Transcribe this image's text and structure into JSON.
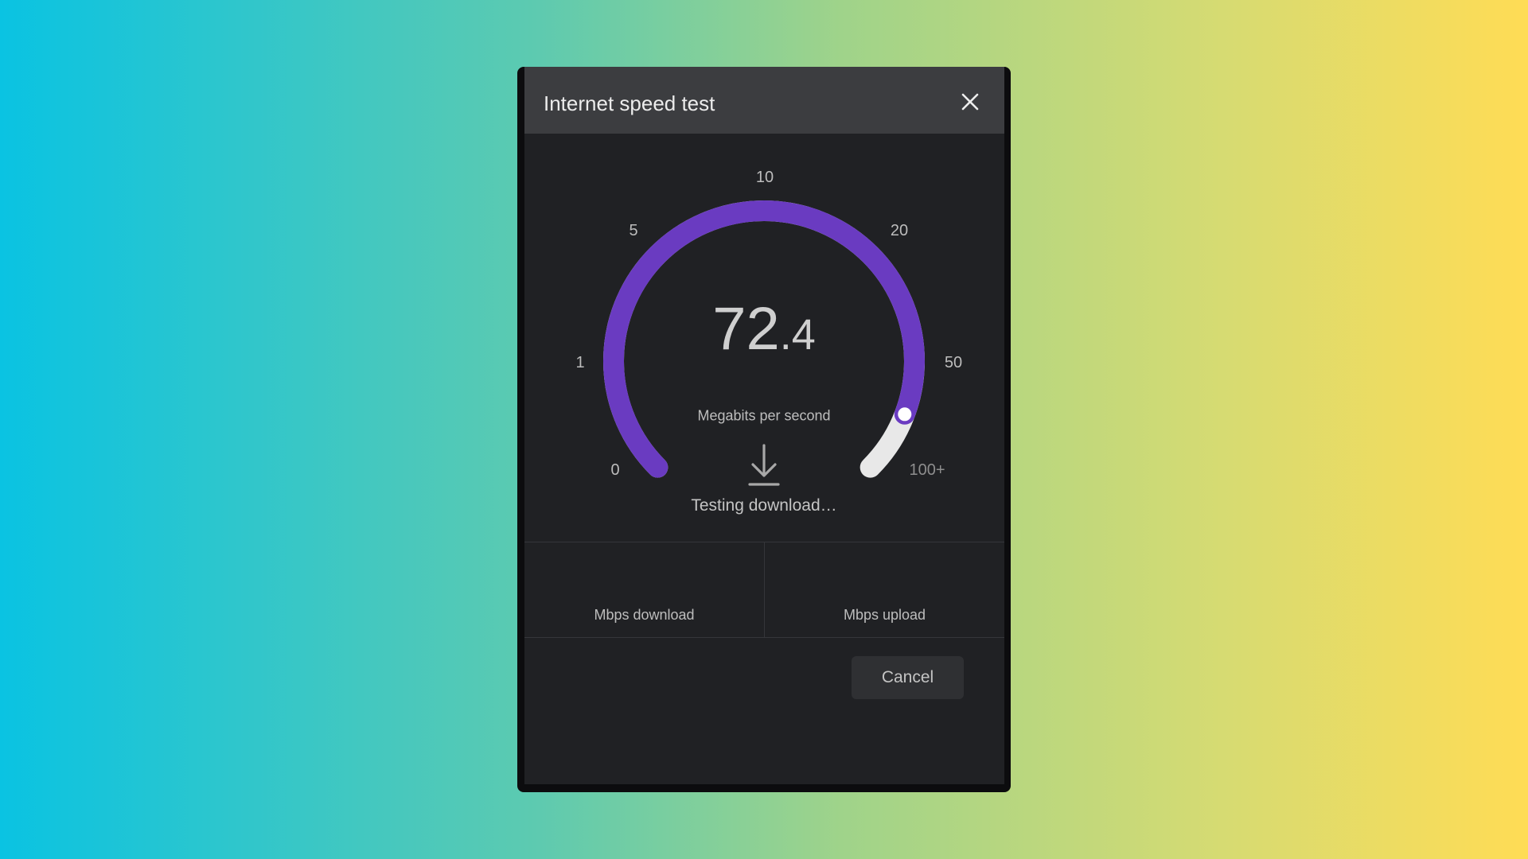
{
  "dialog": {
    "title": "Internet speed test",
    "close_icon": "close-icon"
  },
  "gauge": {
    "ticks": [
      "0",
      "1",
      "5",
      "10",
      "20",
      "50",
      "100+"
    ],
    "progress_fraction": 0.91,
    "colors": {
      "filled": "#6a3bc1",
      "track": "#e8e8e8",
      "knob_border": "#6a3bc1"
    }
  },
  "speed": {
    "integer": "72",
    "decimal": ".4",
    "unit": "Megabits per second"
  },
  "status": {
    "icon": "download-icon",
    "text": "Testing download…"
  },
  "results": {
    "download_label": "Mbps download",
    "upload_label": "Mbps upload"
  },
  "actions": {
    "cancel_label": "Cancel"
  }
}
